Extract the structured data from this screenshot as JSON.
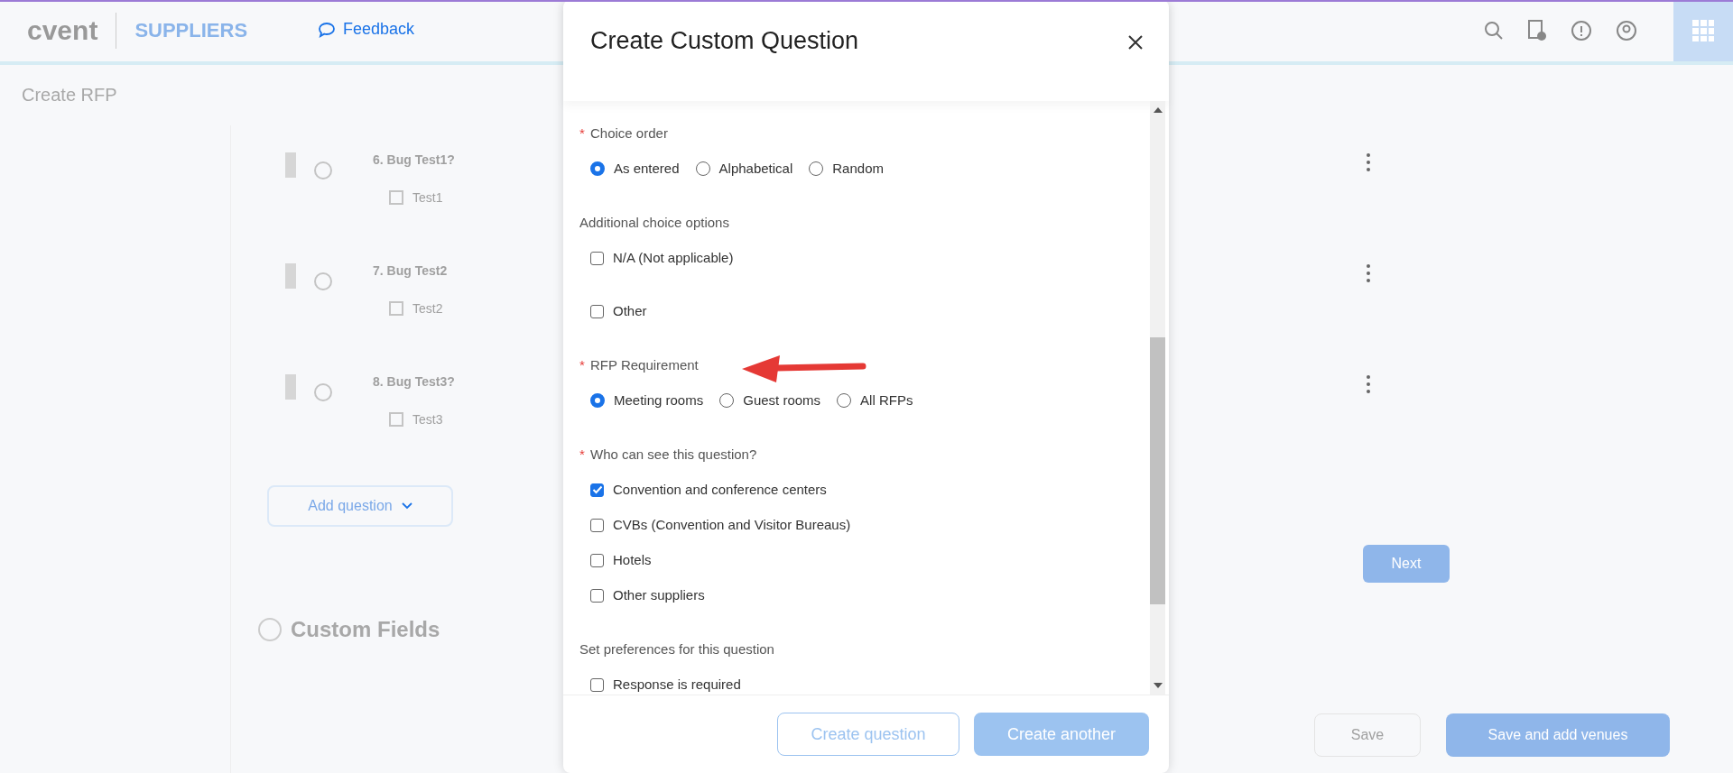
{
  "header": {
    "logo": "cvent",
    "section": "SUPPLIERS",
    "feedback": "Feedback"
  },
  "page": {
    "title": "Create RFP",
    "questions": [
      {
        "title": "6. Bug Test1?",
        "choice": "Test1"
      },
      {
        "title": "7. Bug Test2",
        "choice": "Test2"
      },
      {
        "title": "8. Bug Test3?",
        "choice": "Test3"
      }
    ],
    "add_question": "Add question",
    "next": "Next",
    "next_section": "Custom Fields",
    "footer_buttons": [
      {
        "label": "Save",
        "kind": "secondary"
      },
      {
        "label": "Save and add venues",
        "kind": "primary"
      }
    ]
  },
  "modal": {
    "title": "Create Custom Question",
    "sections": [
      {
        "label": "Choice order",
        "required_mark": "*",
        "kind": "radio",
        "options": [
          {
            "label": "As entered",
            "selected": true
          },
          {
            "label": "Alphabetical",
            "selected": false
          },
          {
            "label": "Random",
            "selected": false
          }
        ]
      },
      {
        "label": "Additional choice options",
        "kind": "checkbox",
        "options": [
          {
            "label": "N/A (Not applicable)",
            "checked": false
          },
          {
            "label": "Other",
            "checked": false
          }
        ]
      },
      {
        "label": "RFP Requirement",
        "required_mark": "*",
        "kind": "radio",
        "options": [
          {
            "label": "Meeting rooms",
            "selected": true
          },
          {
            "label": "Guest rooms",
            "selected": false
          },
          {
            "label": "All RFPs",
            "selected": false
          }
        ]
      },
      {
        "label": "Who can see this question?",
        "required_mark": "*",
        "kind": "checkbox",
        "options": [
          {
            "label": "Convention and conference centers",
            "checked": true
          },
          {
            "label": "CVBs (Convention and Visitor Bureaus)",
            "checked": false
          },
          {
            "label": "Hotels",
            "checked": false
          },
          {
            "label": "Other suppliers",
            "checked": false
          }
        ]
      },
      {
        "label": "Set preferences for this question",
        "kind": "checkbox",
        "options": [
          {
            "label": "Response is required",
            "checked": false
          }
        ]
      }
    ],
    "buttons": [
      {
        "label": "Create question",
        "kind": "secondary"
      },
      {
        "label": "Create another",
        "kind": "primary"
      }
    ]
  }
}
